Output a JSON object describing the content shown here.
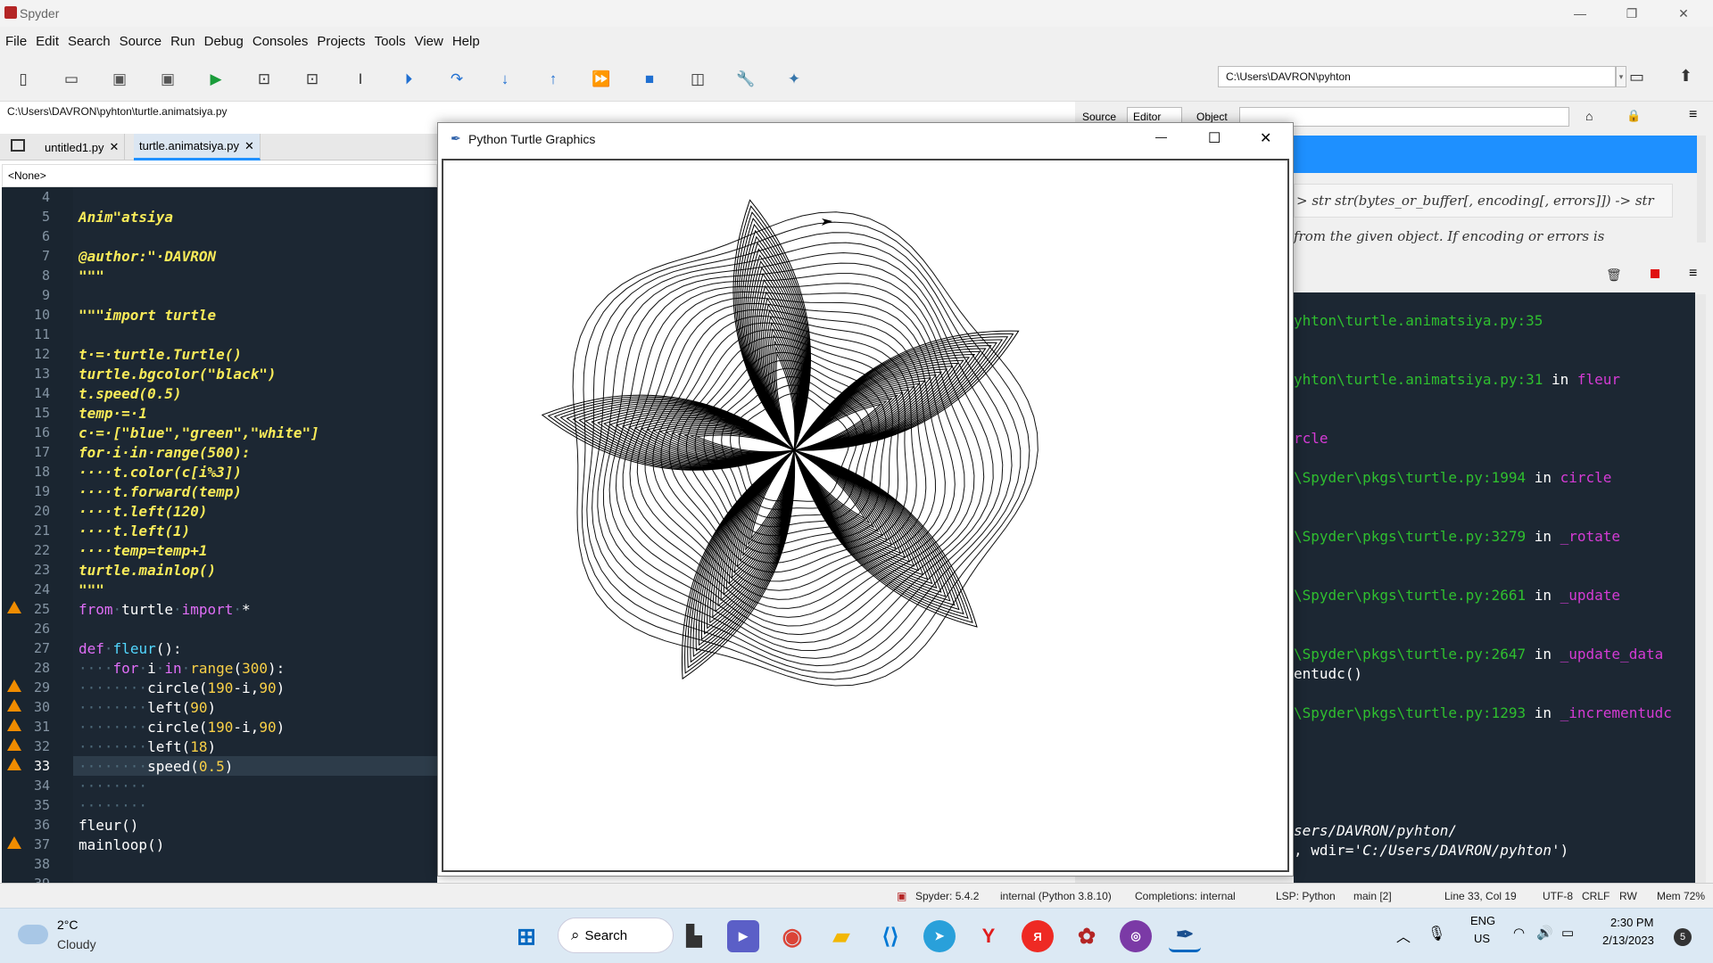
{
  "window": {
    "title": "Spyder",
    "minimize": "—",
    "maximize": "❐",
    "close": "✕"
  },
  "menu": [
    "File",
    "Edit",
    "Search",
    "Source",
    "Run",
    "Debug",
    "Consoles",
    "Projects",
    "Tools",
    "View",
    "Help"
  ],
  "toolbar": {
    "working_dir": "C:\\Users\\DAVRON\\pyhton"
  },
  "editor": {
    "file_path": "C:\\Users\\DAVRON\\pyhton\\turtle.animatsiya.py",
    "tabs": [
      {
        "label": "untitled1.py",
        "close": "✕"
      },
      {
        "label": "turtle.animatsiya.py",
        "close": "✕"
      }
    ],
    "outline": "<None>",
    "line_numbers": [
      "4",
      "5",
      "6",
      "7",
      "8",
      "9",
      "10",
      "11",
      "12",
      "13",
      "14",
      "15",
      "16",
      "17",
      "18",
      "19",
      "20",
      "21",
      "22",
      "23",
      "24",
      "25",
      "26",
      "27",
      "28",
      "29",
      "30",
      "31",
      "32",
      "33",
      "34",
      "35",
      "36",
      "37",
      "38",
      "39"
    ],
    "current_line": "33",
    "lines": {
      "l5": "Anim\"atsiya",
      "l7": "@author:\"·DAVRON",
      "l8": "\"\"\"",
      "l10": "\"\"\"import turtle",
      "l12": "t·=·turtle.Turtle()",
      "l13": "turtle.bgcolor(\"black\")",
      "l14": "t.speed(0.5)",
      "l15": "temp·=·1",
      "l16": "c·=·[\"blue\",\"green\",\"white\"]",
      "l17": "for·i·in·range(500):",
      "l18": "····t.color(c[i%3])",
      "l19": "····t.forward(temp)",
      "l20": "····t.left(120)",
      "l21": "····t.left(1)",
      "l22": "····temp=temp+1",
      "l23": "turtle.mainlop()",
      "l24": "\"\"\"",
      "l25a": "from",
      "l25b": "turtle",
      "l25c": "import",
      "l25d": "*",
      "l27a": "def",
      "l27b": "fleur",
      "l27c": "():",
      "l28a": "····",
      "l28b": "for",
      "l28c": "i",
      "l28d": "in",
      "l28e": "range",
      "l28f": "(",
      "l28g": "300",
      "l28h": "):",
      "l29a": "········",
      "l29b": "circle(",
      "l29c": "190",
      "l29d": "-i,",
      "l29e": "90",
      "l29f": ")",
      "l30a": "········",
      "l30b": "left(",
      "l30c": "90",
      "l30d": ")",
      "l31a": "········",
      "l31b": "circle(",
      "l31c": "190",
      "l31d": "-i,",
      "l31e": "90",
      "l31f": ")",
      "l32a": "········",
      "l32b": "left(",
      "l32c": "18",
      "l32d": ")",
      "l33a": "········",
      "l33b": "speed(",
      "l33c": "0.5",
      "l33d": ")",
      "l34": "········",
      "l35": "········",
      "l36": "fleur()",
      "l37": "mainloop()"
    }
  },
  "help": {
    "source_label": "Source",
    "editor_label": "Editor",
    "object_label": "Object",
    "signature": "> str str(bytes_or_buffer[, encoding[, errors]]) -> str",
    "description": "from the given object. If encoding or errors is"
  },
  "console": {
    "lines": [
      {
        "g": "yhton\\turtle.animatsiya.py:35",
        "w": "",
        "m": ""
      },
      {
        "g": "yhton\\turtle.animatsiya.py:31",
        "w": " in ",
        "m": "fleur"
      },
      {
        "g": "",
        "w": "",
        "m": "rcle"
      },
      {
        "g": "\\Spyder\\pkgs\\turtle.py:1994",
        "w": " in ",
        "m": "circle"
      },
      {
        "g": "\\Spyder\\pkgs\\turtle.py:3279",
        "w": " in ",
        "m": "_rotate"
      },
      {
        "g": "\\Spyder\\pkgs\\turtle.py:2661",
        "w": " in ",
        "m": "_update"
      },
      {
        "g": "\\Spyder\\pkgs\\turtle.py:2647",
        "w": " in ",
        "m": "_update_data"
      },
      {
        "g": "",
        "w": "entudc()",
        "m": ""
      },
      {
        "g": "\\Spyder\\pkgs\\turtle.py:1293",
        "w": " in ",
        "m": "_incrementudc"
      }
    ],
    "run_a": "sers/DAVRON/pyhton/",
    "run_b": ", wdir=",
    "run_c": "'C:/Users/DAVRON/pyhton'",
    "run_d": ")"
  },
  "turtle_window": {
    "title": "Python Turtle Graphics",
    "minimize": "—",
    "maximize": "☐",
    "close": "✕"
  },
  "statusbar": {
    "spyder": "Spyder: 5.4.2",
    "interpreter": "internal (Python 3.8.10)",
    "completions": "Completions: internal",
    "lsp": "LSP: Python",
    "git": "main [2]",
    "cursor": "Line 33, Col 19",
    "encoding": "UTF-8",
    "eol": "CRLF",
    "perm": "RW",
    "mem": "Mem 72%"
  },
  "taskbar": {
    "weather_temp": "2°C",
    "weather_desc": "Cloudy",
    "search": "Search",
    "lang": "ENG",
    "region": "US",
    "time": "2:30 PM",
    "date": "2/13/2023",
    "badge": "5"
  },
  "colors": {
    "editor_bg": "#1c2733",
    "accent_blue": "#1e90ff",
    "warning": "#f08c00"
  }
}
